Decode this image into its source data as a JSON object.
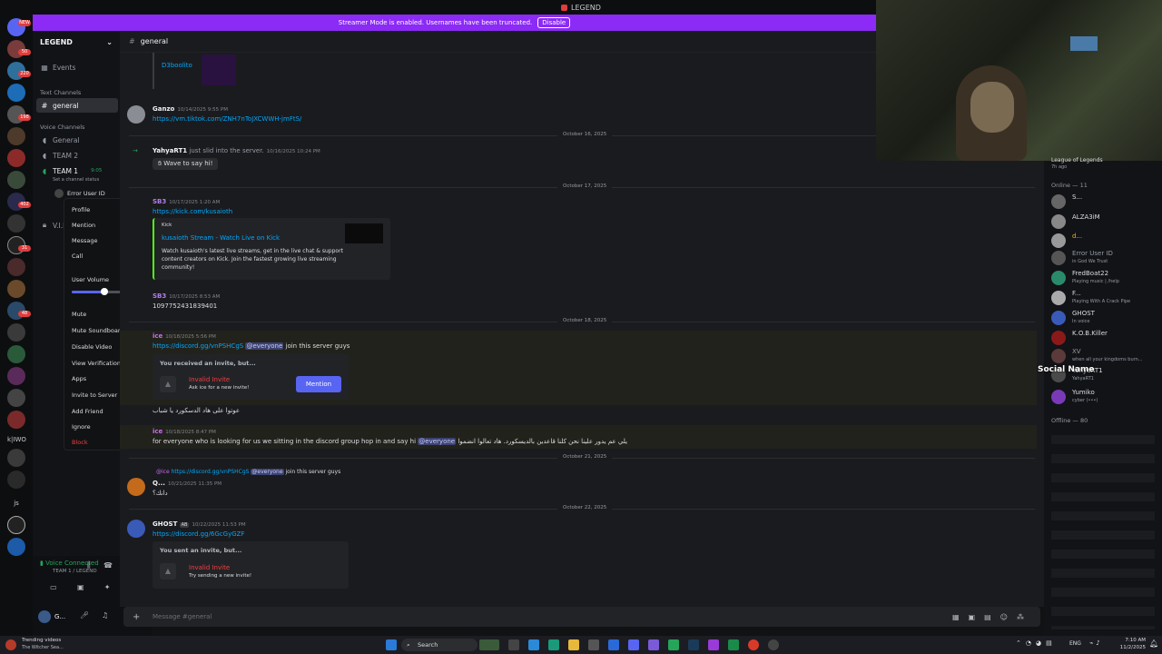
{
  "window": {
    "title": "LEGEND"
  },
  "banner": {
    "text": "Streamer Mode is enabled. Usernames have been truncated.",
    "button": "Disable"
  },
  "rail": {
    "new_badge": "NEW",
    "badges": [
      "50",
      "220",
      "198",
      "402",
      "31",
      "48"
    ],
    "labels": [
      "k|IWO",
      "js"
    ]
  },
  "sidebar": {
    "server_name": "LEGEND",
    "events": "Events",
    "text_cat": "Text Channels",
    "general": "general",
    "voice_cat": "Voice Channels",
    "voice_general": "General",
    "team2": "TEAM 2",
    "team1": "TEAM 1",
    "team1_time": "9:05",
    "status_hint": "Set a channel status",
    "voice_user": "Error User ID",
    "vip": "V.I.P"
  },
  "context_menu": {
    "profile": "Profile",
    "mention": "Mention",
    "message": "Message",
    "call": "Call",
    "volume": "User Volume",
    "volume_level": 0.46,
    "mute": "Mute",
    "mute_soundboard": "Mute Soundboard",
    "disable_video": "Disable Video",
    "view_verification": "View Verification Code",
    "apps": "Apps",
    "invite": "Invite to Server",
    "add_friend": "Add Friend",
    "ignore": "Ignore",
    "block": "Block"
  },
  "userbar": {
    "voice": "Voice Connected",
    "voice_sub": "TEAM 1 / LEGEND",
    "user": "G..."
  },
  "chat": {
    "channel": "general",
    "top_name": "D3boolito",
    "ganzo": {
      "name": "Ganzo",
      "time": "10/14/2025 9:55 PM",
      "link": "https://vm.tiktok.com/ZNH7nToJXCWWH-jmFtS/"
    },
    "d1": "October 16, 2025",
    "yahya": {
      "name": "YahyaRT1",
      "text": "just slid into the server.",
      "time": "10/16/2025 10:24 PM",
      "wave": "Wave to say hi!"
    },
    "d2": "October 17, 2025",
    "sb3a": {
      "name": "SB3",
      "time": "10/17/2025 1:20 AM",
      "link": "https://kick.com/kusaioth"
    },
    "embed": {
      "site": "Kick",
      "title": "kusaioth Stream - Watch Live on Kick",
      "desc": "Watch kusaioth's latest live streams, get in the live chat & support content creators on Kick. Join the fastest growing live streaming community!"
    },
    "sb3b": {
      "name": "SB3",
      "time": "10/17/2025 8:53 AM",
      "text": "1097752431839401"
    },
    "d3": "October 18, 2025",
    "ice": {
      "name": "ice",
      "time": "10/18/2025 5:56 PM",
      "link": "https://discord.gg/vnPSHCgS",
      "mention": "@everyone",
      "text": "join this server guys"
    },
    "invite1": {
      "head": "You received an invite, but...",
      "title": "Invalid Invite",
      "sub": "Ask ice for a new invite!",
      "button": "Mention"
    },
    "arabic1": "عوتوا على هاد الدسكورد يا شباب",
    "ice2": {
      "name": "ice",
      "time": "10/18/2025 8:47 PM",
      "text1": "for everyone who is looking for us we sitting in the discord group hop in and say hi",
      "mention": "@everyone",
      "text2": "يلي عم يدور علينا نحن كلنا قاعدين بالديسكورد. هاد تعالوا انضموا"
    },
    "d4": "October 21, 2025",
    "reply": {
      "name": "@ice",
      "link": "https://discord.gg/vnPSHCgS",
      "mention": "@everyone",
      "text": "join this server guys"
    },
    "q": {
      "name": "Q...",
      "time": "10/21/2025 11:35 PM",
      "text": "دانك؟"
    },
    "d5": "October 22, 2025",
    "ghost": {
      "name": "GHOST",
      "tag": "AB",
      "time": "10/22/2025 11:53 PM",
      "link": "https://discord.gg/6GcGyGZF"
    },
    "invite2": {
      "head": "You sent an invite, but...",
      "title": "Invalid Invite",
      "sub": "Try sending a new invite!"
    },
    "placeholder": "Message #general"
  },
  "members": {
    "top": "League of Legends",
    "top_sub": "7h ago",
    "online": "Online — 11",
    "offline": "Offline — 80",
    "list": [
      {
        "name": "S...",
        "status": ""
      },
      {
        "name": "ALZA3iM",
        "status": ""
      },
      {
        "name": "d...",
        "status": ""
      },
      {
        "name": "Error User ID",
        "status": "in God We Trust"
      },
      {
        "name": "FredBoat22",
        "status": "Playing music | /help"
      },
      {
        "name": "F...",
        "status": "Playing With A Crack Pipe"
      },
      {
        "name": "GHOST",
        "status": "In voice"
      },
      {
        "name": "K.O.B.Killer",
        "status": ""
      },
      {
        "name": "XV",
        "status": "when all your kingdoms burn..."
      },
      {
        "name": "YahyaRT1",
        "status": "YahyaRT1"
      },
      {
        "name": "Yumiko",
        "status": "cyber (•••)"
      }
    ]
  },
  "overlay": {
    "social": "Social Name"
  },
  "taskbar": {
    "weather": "Trending videos",
    "weather_sub": "The Witcher Sea...",
    "search": "Search",
    "lang": "ENG",
    "time": "7:10 AM",
    "date": "11/2/2025"
  }
}
